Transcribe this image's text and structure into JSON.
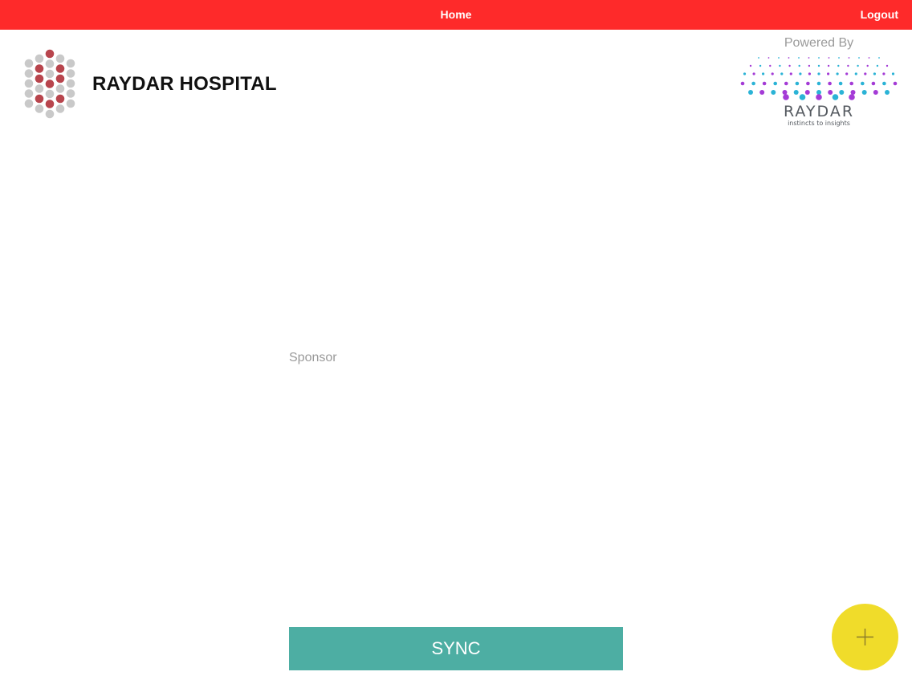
{
  "header": {
    "title": "Home",
    "logout_label": "Logout",
    "background_color": "#fe2a2a"
  },
  "brand": {
    "hospital_name": "RAYDAR HOSPITAL",
    "logo_icon": "hex-dot-logo-icon"
  },
  "powered": {
    "label": "Powered By",
    "brand_name": "RAYDAR",
    "tagline": "instincts to insights",
    "logo_icon": "dot-fan-logo-icon"
  },
  "main": {
    "sponsor_label": "Sponsor"
  },
  "footer": {
    "sync_label": "SYNC",
    "sync_color": "#4daea3",
    "fab_icon": "plus-icon",
    "fab_color": "#f0dc2a"
  }
}
